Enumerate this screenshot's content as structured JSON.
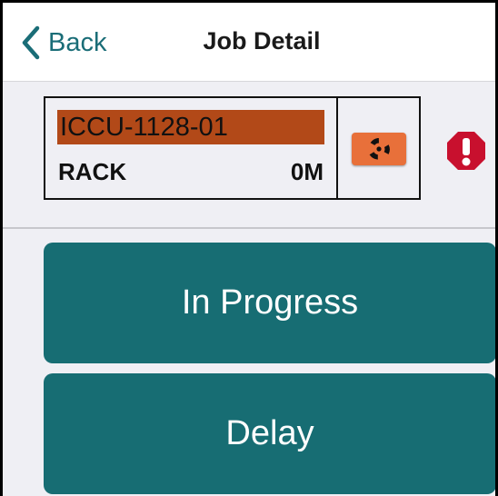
{
  "nav": {
    "back_label": "Back",
    "title": "Job Detail"
  },
  "job": {
    "id": "ICCU-1128-01",
    "id_highlight_color": "#b24918",
    "type": "RACK",
    "distance": "0M",
    "hazard_icon": "radiation-icon",
    "hazard_color": "#e8703a",
    "alert_icon": "alert-icon",
    "alert_color": "#c8102e"
  },
  "actions": {
    "in_progress_label": "In Progress",
    "delay_label": "Delay",
    "button_color": "#176d73"
  },
  "colors": {
    "accent": "#1a6d77"
  }
}
